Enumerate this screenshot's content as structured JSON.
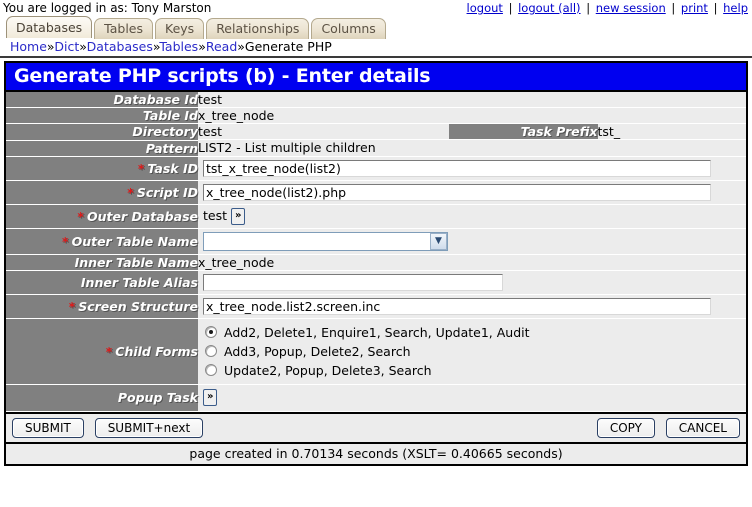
{
  "topbar": {
    "user_text": "You are logged in as: Tony Marston",
    "links": [
      {
        "label": "logout"
      },
      {
        "label": "logout (all)"
      },
      {
        "label": "new session"
      },
      {
        "label": "print"
      },
      {
        "label": "help"
      }
    ],
    "separator": "|"
  },
  "tabs": [
    {
      "label": "Databases",
      "active": true
    },
    {
      "label": "Tables",
      "active": false
    },
    {
      "label": "Keys",
      "active": false
    },
    {
      "label": "Relationships",
      "active": false
    },
    {
      "label": "Columns",
      "active": false
    }
  ],
  "breadcrumb": {
    "items": [
      "Home",
      "Dict",
      "Databases",
      "Tables",
      "Read",
      "Generate PHP"
    ],
    "separator": "»"
  },
  "panel": {
    "title": "Generate PHP scripts (b) - Enter details",
    "required_marker": "*",
    "fields": {
      "database_id": {
        "label": "Database Id",
        "value": "test"
      },
      "table_id": {
        "label": "Table Id",
        "value": "x_tree_node"
      },
      "directory": {
        "label": "Directory",
        "value": "test"
      },
      "task_prefix": {
        "label": "Task Prefix",
        "value": "tst_"
      },
      "pattern": {
        "label": "Pattern",
        "value": "LIST2 - List multiple children"
      },
      "task_id": {
        "label": "Task ID",
        "value": "tst_x_tree_node(list2)",
        "placeholder": ""
      },
      "script_id": {
        "label": "Script ID",
        "value": "x_tree_node(list2).php",
        "placeholder": ""
      },
      "outer_database": {
        "label": "Outer Database",
        "value": "test",
        "button_label": "»"
      },
      "outer_table_name": {
        "label": "Outer Table Name",
        "value": "",
        "options": [
          ""
        ]
      },
      "inner_table_name": {
        "label": "Inner Table Name",
        "value": "x_tree_node"
      },
      "inner_table_alias": {
        "label": "Inner Table Alias",
        "value": "",
        "placeholder": ""
      },
      "screen_structure": {
        "label": "Screen Structure",
        "value": "x_tree_node.list2.screen.inc",
        "placeholder": ""
      },
      "child_forms": {
        "label": "Child Forms",
        "options": [
          {
            "label": "Add2, Delete1, Enquire1, Search, Update1, Audit",
            "selected": true
          },
          {
            "label": "Add3, Popup, Delete2, Search",
            "selected": false
          },
          {
            "label": "Update2, Popup, Delete3, Search",
            "selected": false
          }
        ]
      },
      "popup_task": {
        "label": "Popup Task",
        "button_label": "»"
      }
    }
  },
  "buttons": {
    "submit": "SUBMIT",
    "submit_next": "SUBMIT+next",
    "copy": "COPY",
    "cancel": "CANCEL"
  },
  "footer": {
    "text": "page created in 0.70134 seconds (XSLT= 0.40665 seconds)"
  },
  "colors": {
    "title_bg": "#0000f0",
    "label_bg": "#808080",
    "value_bg": "#ececec",
    "required": "#e01b1b",
    "link": "#0000cc"
  }
}
